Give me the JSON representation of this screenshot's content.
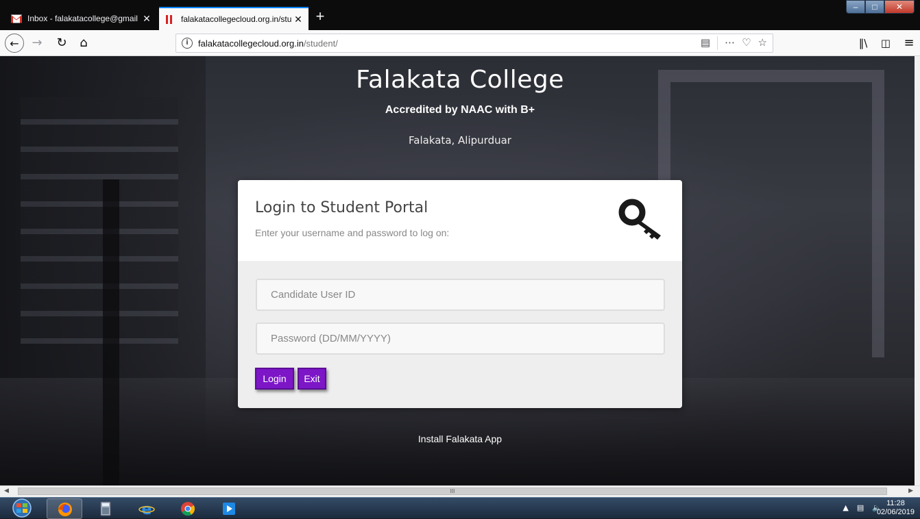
{
  "browser": {
    "tabs": [
      {
        "label": "Inbox - falakatacollege@gmail",
        "close": "✕",
        "active": false
      },
      {
        "label": "falakatacollegecloud.org.in/stu",
        "close": "✕",
        "active": true
      }
    ],
    "new_tab": "+",
    "url_domain": "falakatacollegecloud.org.in",
    "url_path": "/student/",
    "info_glyph": "i",
    "reader_icon": "reader-view-icon",
    "page_actions_icon": "ellipsis-icon",
    "pocket_icon": "pocket-icon",
    "bookmark_icon": "star-icon",
    "library_icon": "library-icon",
    "sidebar_icon": "sidebar-icon",
    "menu_icon": "hamburger-icon"
  },
  "page": {
    "college_name": "Falakata College",
    "accreditation": "Accredited by NAAC with B+",
    "location": "Falakata, Alipurduar",
    "login": {
      "title": "Login to Student Portal",
      "subtitle": "Enter your username and password to log on:",
      "user_placeholder": "Candidate User ID",
      "password_placeholder": "Password (DD/MM/YYYY)",
      "login_label": "Login",
      "exit_label": "Exit"
    },
    "install_app": "Install Falakata App",
    "scroll_thumb": "III"
  },
  "taskbar": {
    "apps": [
      "firefox-icon",
      "calculator-icon",
      "internet-explorer-icon",
      "chrome-icon",
      "media-player-icon"
    ],
    "clock_time": "11:28",
    "clock_date": "02/06/2019"
  },
  "colors": {
    "accent_button": "#7d16c7",
    "tab_accent": "#0a84ff",
    "gmail_red": "#d93025"
  }
}
